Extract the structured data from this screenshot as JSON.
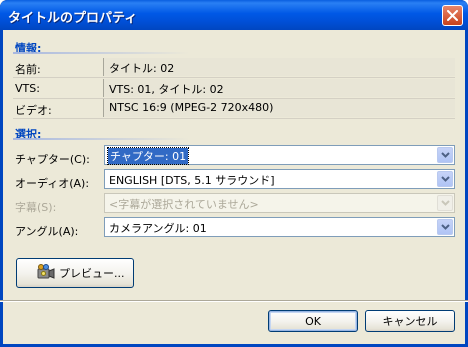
{
  "window": {
    "title": "タイトルのプロパティ"
  },
  "info": {
    "section_title": "情報:",
    "rows": [
      {
        "label": "名前:",
        "value": "タイトル: 02"
      },
      {
        "label": "VTS:",
        "value": "VTS: 01, タイトル: 02"
      },
      {
        "label": "ビデオ:",
        "value": "NTSC 16:9 (MPEG-2 720x480)"
      }
    ]
  },
  "select": {
    "section_title": "選択:",
    "chapter": {
      "label": "チャプター(C):",
      "value": "チャプター: 01"
    },
    "audio": {
      "label": "オーディオ(A):",
      "value": "ENGLISH [DTS, 5.1 サラウンド]"
    },
    "subtitle": {
      "label": "字幕(S):",
      "value": "<字幕が選択されていません>"
    },
    "angle": {
      "label": "アングル(A):",
      "value": "カメラアングル: 01"
    }
  },
  "buttons": {
    "preview": "プレビュー...",
    "ok": "OK",
    "cancel": "キャンセル"
  },
  "icons": {
    "close": "close-icon",
    "preview": "preview-icon",
    "dropdown": "chevron-down-icon"
  },
  "colors": {
    "titlebar": "#0058e6",
    "section_title": "#0046c0",
    "client_bg": "#ece9d8",
    "selection": "#316ac5"
  }
}
